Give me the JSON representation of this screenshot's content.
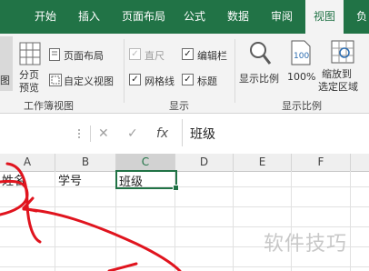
{
  "tabs": [
    "开始",
    "插入",
    "页面布局",
    "公式",
    "数据",
    "审阅",
    "视图",
    "负"
  ],
  "active_tab": "视图",
  "ribbon": {
    "workbook_views": {
      "btn_partial": "图",
      "page_break_preview": [
        "分页",
        "预览"
      ],
      "page_layout": "页面布局",
      "custom_views": "自定义视图",
      "group_label": "工作簿视图"
    },
    "show": {
      "ruler": "直尺",
      "formula_bar": "编辑栏",
      "gridlines": "网格线",
      "headings": "标题",
      "group_label": "显示"
    },
    "zoom": {
      "zoom": "显示比例",
      "zoom_100": "100%",
      "zoom_to_selection": [
        "缩放到",
        "选定区域"
      ],
      "group_label": "显示比例"
    }
  },
  "formula_bar": {
    "cancel": "✕",
    "enter": "✓",
    "fx": "fx",
    "value": "班级"
  },
  "grid": {
    "columns": [
      "A",
      "B",
      "C",
      "D",
      "E",
      "F"
    ],
    "selected_column": "C",
    "row1": [
      "姓名",
      "学号",
      "班级"
    ]
  },
  "watermark": "软件技巧",
  "colors": {
    "accent": "#217346",
    "annotation": "#e0141e"
  }
}
